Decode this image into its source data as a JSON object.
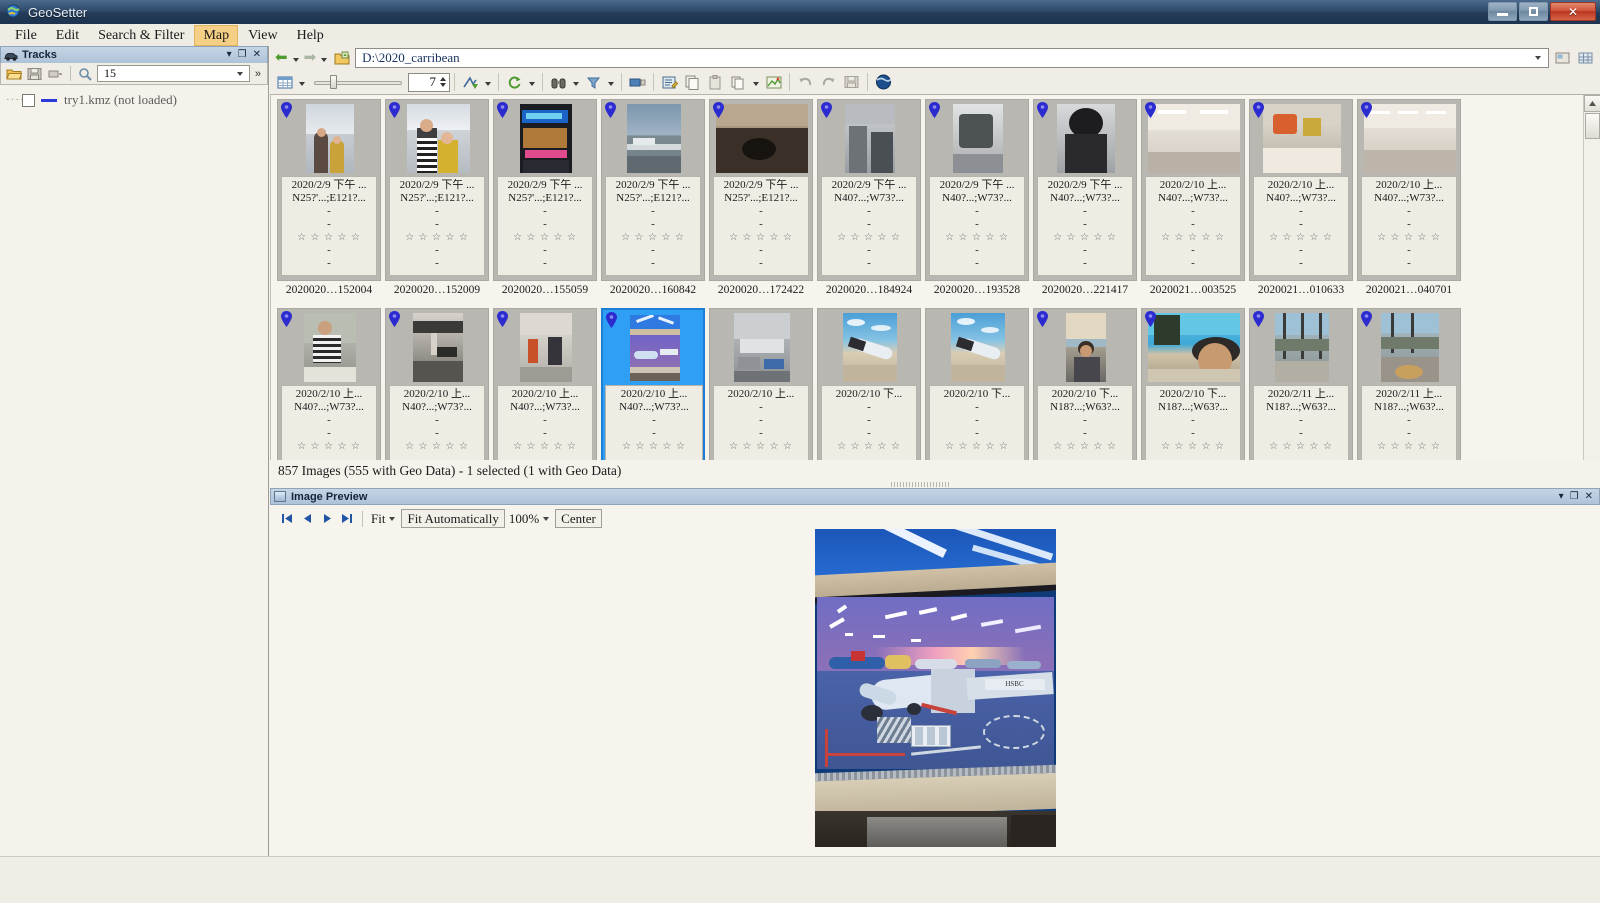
{
  "window": {
    "title": "GeoSetter",
    "app_icon": "geosetter-globe-icon",
    "minimize_label": "Minimize",
    "restore_label": "Restore",
    "close_label": "✕"
  },
  "menu": {
    "items": [
      {
        "label": "File",
        "active": false
      },
      {
        "label": "Edit",
        "active": false
      },
      {
        "label": "Search & Filter",
        "active": false
      },
      {
        "label": "Map",
        "active": true
      },
      {
        "label": "View",
        "active": false
      },
      {
        "label": "Help",
        "active": false
      }
    ]
  },
  "tracks_panel": {
    "title": "Tracks",
    "caption_icon": "car-icon",
    "caption_buttons": [
      "▾",
      "❐",
      "✕"
    ],
    "toolbar": {
      "open_icon": "folder-open-icon",
      "save_icon": "save-icon",
      "rename_icon": "rename-icon",
      "search_icon": "magnifier-icon",
      "search_value": "15",
      "overflow_label": "»"
    },
    "items": [
      {
        "label": "try1.kmz (not loaded)",
        "checked": false,
        "color": "#2b3ad8"
      }
    ]
  },
  "main_toolbar": {
    "back_icon": "back-arrow-icon",
    "forward_icon": "forward-arrow-icon",
    "folder_icon": "folder-up-icon",
    "path_value": "D:\\2020_carribean",
    "path_dropdown_icon": "chevron-down-icon",
    "right_icons": [
      "image-list-icon",
      "grid-icon"
    ],
    "view_mode_icon": "table-view-icon",
    "zoom_value": "7",
    "icons": [
      "geotag-icon",
      "refresh-icon",
      "binoculars-icon",
      "filter-icon",
      "rename-icon",
      "edit-data-icon",
      "copy-icon",
      "paste-icon",
      "copy-multi-icon",
      "map-export-icon",
      "undo-icon",
      "redo-icon",
      "save-icon",
      "google-earth-icon"
    ]
  },
  "grid": {
    "status_text": "857 Images (555 with Geo Data) - 1 selected (1 with Geo Data)",
    "rows": [
      {
        "cells": [
          {
            "date": "2020/2/9 下午 ...",
            "coords": "N25?'...;E121?...",
            "has_pin": true,
            "selected": false,
            "filename": "2020020…152004",
            "stars": 5,
            "photo": "people-airport-skylight"
          },
          {
            "date": "2020/2/9 下午 ...",
            "coords": "N25?'...;E121?...",
            "has_pin": true,
            "selected": false,
            "filename": "2020020…152009",
            "stars": 5,
            "photo": "couple-airport-skylight"
          },
          {
            "date": "2020/2/9 下午 ...",
            "coords": "N25?'...;E121?...",
            "has_pin": true,
            "selected": false,
            "filename": "2020020…155059",
            "stars": 5,
            "photo": "terminal-shops-sign"
          },
          {
            "date": "2020/2/9 下午 ...",
            "coords": "N25?'...;E121?...",
            "has_pin": true,
            "selected": false,
            "filename": "2020020…160842",
            "stars": 5,
            "photo": "tarmac-overcast"
          },
          {
            "date": "2020/2/9 下午 ...",
            "coords": "N25?'...;E121?...",
            "has_pin": true,
            "selected": false,
            "filename": "2020020…172422",
            "stars": 5,
            "photo": "seat-table-dark"
          },
          {
            "date": "2020/2/9 下午 ...",
            "coords": "N40?...;W73?...",
            "has_pin": true,
            "selected": false,
            "filename": "2020020…184924",
            "stars": 5,
            "photo": "cabin-interior"
          },
          {
            "date": "2020/2/9 下午 ...",
            "coords": "N40?...;W73?...",
            "has_pin": true,
            "selected": false,
            "filename": "2020020…193528",
            "stars": 5,
            "photo": "luggage-cart"
          },
          {
            "date": "2020/2/9 下午 ...",
            "coords": "N40?...;W73?...",
            "has_pin": true,
            "selected": false,
            "filename": "2020020…221417",
            "stars": 5,
            "photo": "person-dark-jacket"
          },
          {
            "date": "2020/2/10 上...",
            "coords": "N40?...;W73?...",
            "has_pin": true,
            "selected": false,
            "filename": "2020021…003525",
            "stars": 5,
            "photo": "terminal-corridor"
          },
          {
            "date": "2020/2/10 上...",
            "coords": "N40?...;W73?...",
            "has_pin": true,
            "selected": false,
            "filename": "2020021…010633",
            "stars": 5,
            "photo": "food-court"
          },
          {
            "date": "2020/2/10 上...",
            "coords": "N40?...;W73?...",
            "has_pin": true,
            "selected": false,
            "filename": "2020021…040701",
            "stars": 5,
            "photo": "terminal-hall"
          }
        ]
      },
      {
        "cells": [
          {
            "date": "2020/2/10 上...",
            "coords": "N40?...;W73?...",
            "has_pin": true,
            "selected": false,
            "filename": "",
            "stars": 5,
            "photo": "man-striped-shirt"
          },
          {
            "date": "2020/2/10 上...",
            "coords": "N40?...;W73?...",
            "has_pin": true,
            "selected": false,
            "filename": "",
            "stars": 5,
            "photo": "counter-dark"
          },
          {
            "date": "2020/2/10 上...",
            "coords": "N40?...;W73?...",
            "has_pin": true,
            "selected": false,
            "filename": "",
            "stars": 5,
            "photo": "airport-walkway"
          },
          {
            "date": "2020/2/10 上...",
            "coords": "N40?...;W73?...",
            "has_pin": true,
            "selected": true,
            "filename": "",
            "stars": 5,
            "photo": "window-sunset-planes"
          },
          {
            "date": "2020/2/10 上...",
            "coords": "",
            "has_pin": false,
            "selected": false,
            "filename": "",
            "stars": 5,
            "photo": "rainy-tarmac"
          },
          {
            "date": "2020/2/10 下...",
            "coords": "",
            "has_pin": false,
            "selected": false,
            "filename": "",
            "stars": 5,
            "photo": "plane-wing-beach"
          },
          {
            "date": "2020/2/10 下...",
            "coords": "",
            "has_pin": false,
            "selected": false,
            "filename": "",
            "stars": 5,
            "photo": "plane-wing-beach-2"
          },
          {
            "date": "2020/2/10 下...",
            "coords": "N18?...;W63?...",
            "has_pin": true,
            "selected": false,
            "filename": "",
            "stars": 5,
            "photo": "man-under-canopy"
          },
          {
            "date": "2020/2/10 下...",
            "coords": "N18?...;W63?...",
            "has_pin": true,
            "selected": false,
            "filename": "",
            "stars": 5,
            "photo": "man-beach-selfie"
          },
          {
            "date": "2020/2/11 上...",
            "coords": "N18?...;W63?...",
            "has_pin": true,
            "selected": false,
            "filename": "",
            "stars": 5,
            "photo": "beach-restaurant"
          },
          {
            "date": "2020/2/11 上...",
            "coords": "N18?...;W63?...",
            "has_pin": true,
            "selected": false,
            "filename": "",
            "stars": 5,
            "photo": "beach-restaurant-2"
          }
        ]
      }
    ]
  },
  "preview_panel": {
    "title": "Image Preview",
    "caption_buttons": [
      "▾",
      "❐",
      "✕"
    ],
    "toolbar": {
      "first_icon": "first-image-icon",
      "prev_icon": "previous-image-icon",
      "next_icon": "next-image-icon",
      "last_icon": "last-image-icon",
      "fit_label": "Fit",
      "fit_mode_label": "Fit Automatically",
      "zoom_label": "100%",
      "center_label": "Center"
    },
    "image_alt": "airport-terminal-window-sunset"
  },
  "colors": {
    "selection": "#2f9ff5",
    "pin": "#2b2bd0",
    "menu_active": "#f5cf86",
    "panel_caption": "#aec2d8",
    "path_text": "#16305e"
  }
}
